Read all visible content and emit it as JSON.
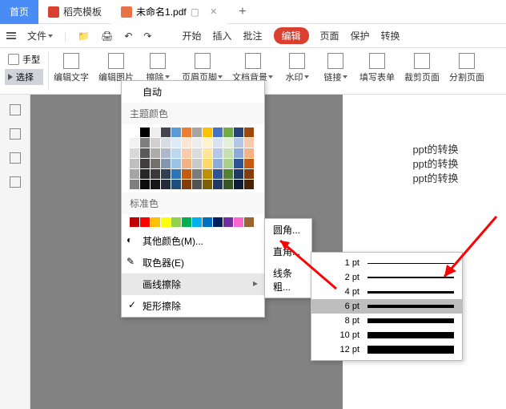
{
  "tabs": {
    "home": "首页",
    "template": "稻壳模板",
    "doc": "未命名1.pdf"
  },
  "menu": {
    "file": "文件",
    "start": "开始",
    "insert": "插入",
    "annotate": "批注",
    "edit": "编辑",
    "page": "页面",
    "protect": "保护",
    "convert": "转换"
  },
  "tools": {
    "hand": "手型",
    "select": "选择",
    "editText": "编辑文字",
    "editImage": "编辑图片",
    "erase": "擦除",
    "header": "页眉页脚",
    "background": "文档背景",
    "watermark": "水印",
    "link": "链接",
    "form": "填写表单",
    "crop": "裁剪页面",
    "split": "分割页面"
  },
  "popup": {
    "auto": "自动",
    "theme": "主题颜色",
    "standard": "标准色",
    "other": "其他颜色(M)...",
    "picker": "取色器(E)",
    "lineErase": "画线擦除",
    "rectErase": "矩形擦除"
  },
  "submenu": {
    "round": "圆角...",
    "square": "直角...",
    "thickness": "线条粗..."
  },
  "pt": {
    "p1": "1 pt",
    "p2": "2 pt",
    "p4": "4 pt",
    "p6": "6 pt",
    "p8": "8 pt",
    "p10": "10 pt",
    "p12": "12 pt"
  },
  "page_text": {
    "l1": "ppt的转换",
    "l2": "ppt的转换",
    "l3": "ppt的转换"
  },
  "chart_data": null,
  "colors": {
    "theme": [
      [
        "#fff",
        "#000",
        "#eee",
        "#445",
        "#5b9bd5",
        "#ed7d31",
        "#a5a5a5",
        "#ffc000",
        "#4472c4",
        "#70ad47",
        "#264478",
        "#9e480e"
      ],
      [
        "#f2f2f2",
        "#7f7f7f",
        "#d0cece",
        "#d6dce4",
        "#deebf6",
        "#fbe5d5",
        "#ededed",
        "#fff2cc",
        "#d9e2f3",
        "#e2efd9",
        "#b4c6e7",
        "#f7caac"
      ],
      [
        "#d8d8d8",
        "#595959",
        "#aeabab",
        "#adb9ca",
        "#bdd7ee",
        "#f7cbac",
        "#dbdbdb",
        "#fee599",
        "#b4c6e7",
        "#c5e0b3",
        "#8eaadb",
        "#f4b183"
      ],
      [
        "#bfbfbf",
        "#3f3f3f",
        "#757070",
        "#8496b0",
        "#9cc3e5",
        "#f4b183",
        "#c9c9c9",
        "#ffd965",
        "#8eaadb",
        "#a8d08d",
        "#2f5496",
        "#c55a11"
      ],
      [
        "#a5a5a5",
        "#262626",
        "#3a3838",
        "#323f4f",
        "#2e75b5",
        "#c55a11",
        "#7b7b7b",
        "#bf9000",
        "#2f5496",
        "#538135",
        "#1f3864",
        "#833c0b"
      ],
      [
        "#7f7f7f",
        "#0c0c0c",
        "#171616",
        "#222a35",
        "#1e4e79",
        "#833c0b",
        "#525252",
        "#7f6000",
        "#1f3864",
        "#375623",
        "#0f1f33",
        "#4a2307"
      ]
    ],
    "standard": [
      "#c00000",
      "#ff0000",
      "#ffc000",
      "#ffff00",
      "#92d050",
      "#00b050",
      "#00b0f0",
      "#0070c0",
      "#002060",
      "#7030a0",
      "#ff66cc",
      "#996633"
    ]
  }
}
